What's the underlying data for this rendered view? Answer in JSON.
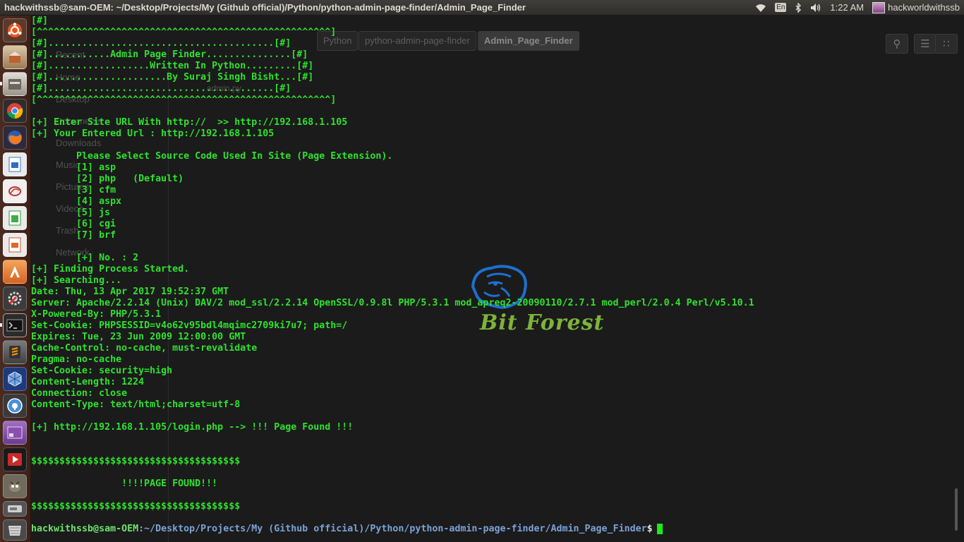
{
  "window": {
    "title": "hackwithssb@sam-OEM: ~/Desktop/Projects/My (Github official)/Python/python-admin-page-finder/Admin_Page_Finder"
  },
  "panel": {
    "keyboard_layout": "En",
    "time": "1:22 AM",
    "username": "hackworldwithssb"
  },
  "launcher": {
    "items": [
      {
        "name": "dash-home-icon"
      },
      {
        "name": "software-installer-icon"
      },
      {
        "name": "files-icon"
      },
      {
        "name": "chrome-icon"
      },
      {
        "name": "firefox-icon"
      },
      {
        "name": "writer-icon"
      },
      {
        "name": "document-viewer-icon"
      },
      {
        "name": "calc-icon"
      },
      {
        "name": "impress-icon"
      },
      {
        "name": "software-center-icon"
      },
      {
        "name": "system-settings-icon"
      },
      {
        "name": "terminal-icon"
      },
      {
        "name": "sublime-text-icon"
      },
      {
        "name": "virtualbox-icon"
      },
      {
        "name": "tor-browser-icon"
      },
      {
        "name": "workspace-switcher-icon"
      },
      {
        "name": "media-player-icon"
      },
      {
        "name": "gimp-icon"
      },
      {
        "name": "external-drive-icon"
      },
      {
        "name": "trash-icon"
      }
    ]
  },
  "background_window": {
    "breadcrumbs": [
      "Python",
      "python-admin-page-finder",
      "Admin_Page_Finder"
    ],
    "sidebar": [
      "Recent",
      "Home",
      "Desktop",
      "Documents",
      "Downloads",
      "Music",
      "Pictures",
      "Videos",
      "Trash",
      "Network"
    ],
    "file": "admin.py"
  },
  "terminal": {
    "lines": [
      "[#]",
      "[^^^^^^^^^^^^^^^^^^^^^^^^^^^^^^^^^^^^^^^^^^^^^^^^^^^^]",
      "[#]........................................[#]",
      "[#]...........Admin Page Finder...............[#]",
      "[#]..................Written In Python.........[#]",
      "[#].....................By Suraj Singh Bisht...[#]",
      "[#]........................................[#]",
      "[^^^^^^^^^^^^^^^^^^^^^^^^^^^^^^^^^^^^^^^^^^^^^^^^^^^^]",
      "",
      "[+] Enter Site URL With http://  >> http://192.168.1.105",
      "[+] Your Entered Url : http://192.168.1.105",
      "",
      "        Please Select Source Code Used In Site (Page Extension).",
      "        [1] asp",
      "        [2] php   (Default)",
      "        [3] cfm",
      "        [4] aspx",
      "        [5] js",
      "        [6] cgi",
      "        [7] brf",
      "",
      "        [+] No. : 2",
      "[+] Finding Process Started.",
      "[+] Searching...",
      "Date: Thu, 13 Apr 2017 19:52:37 GMT",
      "Server: Apache/2.2.14 (Unix) DAV/2 mod_ssl/2.2.14 OpenSSL/0.9.8l PHP/5.3.1 mod_apreq2-20090110/2.7.1 mod_perl/2.0.4 Perl/v5.10.1",
      "X-Powered-By: PHP/5.3.1",
      "Set-Cookie: PHPSESSID=v4o62v95bdl4mqimc2709ki7u7; path=/",
      "Expires: Tue, 23 Jun 2009 12:00:00 GMT",
      "Cache-Control: no-cache, must-revalidate",
      "Pragma: no-cache",
      "Set-Cookie: security=high",
      "Content-Length: 1224",
      "Connection: close",
      "Content-Type: text/html;charset=utf-8",
      "",
      "[+] http://192.168.1.105/login.php --> !!! Page Found !!!",
      "",
      "",
      "$$$$$$$$$$$$$$$$$$$$$$$$$$$$$$$$$$$$$",
      "",
      "                !!!!PAGE FOUND!!!",
      "",
      "$$$$$$$$$$$$$$$$$$$$$$$$$$$$$$$$$$$$$"
    ],
    "prompt_user": "hackwithssb@sam-OEM",
    "prompt_path": ":~/Desktop/Projects/My (Github official)/Python/python-admin-page-finder/Admin_Page_Finder",
    "prompt_symbol": "$"
  },
  "watermark": {
    "text": "Bit Forest"
  },
  "colors": {
    "terminal_text": "#2fe12f",
    "prompt_path": "#7aa2d6",
    "launcher_bg": "#4a2b20",
    "watermark_blue": "#1e6fd0",
    "watermark_green": "#7db33a"
  }
}
